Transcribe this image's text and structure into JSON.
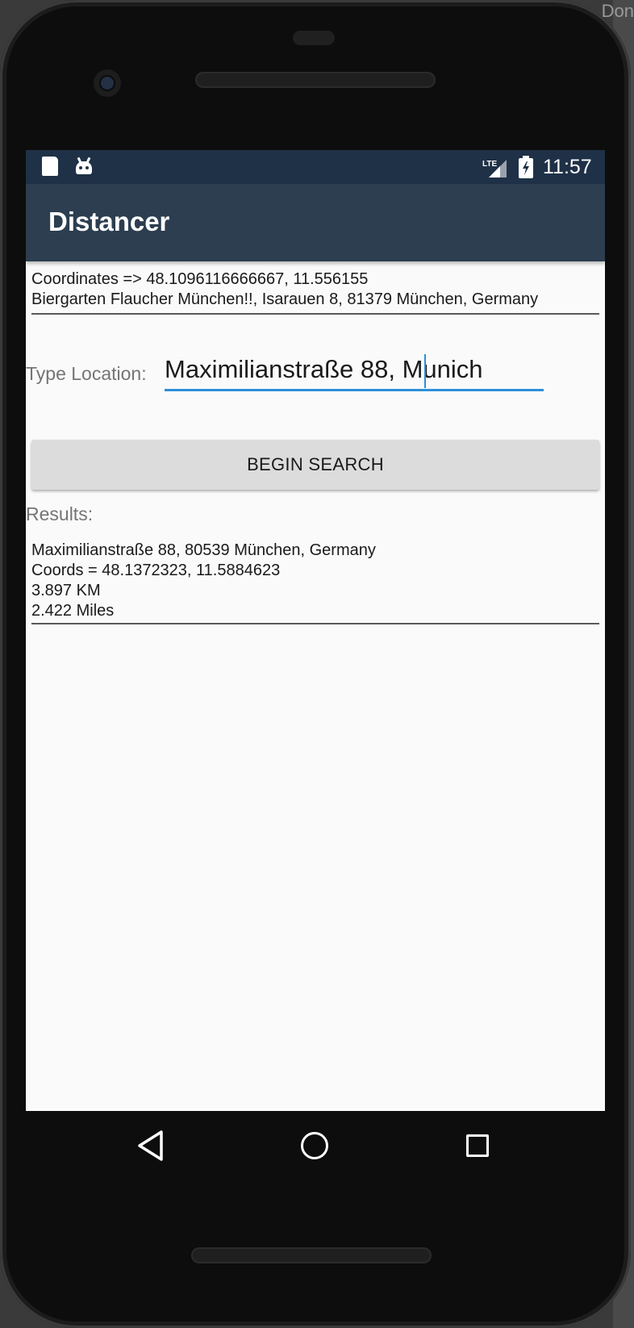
{
  "window": {
    "corner_text": "Don"
  },
  "status_bar": {
    "time": "11:57",
    "network": "LTE",
    "icons": [
      "sd-card-icon",
      "android-icon",
      "lte-signal-icon",
      "battery-charging-icon"
    ]
  },
  "app_bar": {
    "title": "Distancer"
  },
  "origin": {
    "coordinates": "Coordinates => 48.1096116666667, 11.556155",
    "address": "Biergarten Flaucher München!!, Isarauen 8, 81379 München, Germany"
  },
  "location_input": {
    "label": "Type Location:",
    "value": "Maximilianstraße 88, Munich"
  },
  "search_button": {
    "label": "BEGIN SEARCH"
  },
  "results": {
    "label": "Results:",
    "lines": [
      "Maximilianstraße 88, 80539 München, Germany",
      "Coords = 48.1372323, 11.5884623",
      "3.897 KM",
      "2.422 Miles"
    ]
  },
  "nav_bar": {
    "icons": [
      "back-icon",
      "home-icon",
      "recents-icon"
    ]
  },
  "colors": {
    "status_bar": "#1f3147",
    "app_bar": "#2c3e50",
    "accent": "#2e8fd9",
    "background": "#fafafa",
    "button": "#dcdcdc"
  }
}
